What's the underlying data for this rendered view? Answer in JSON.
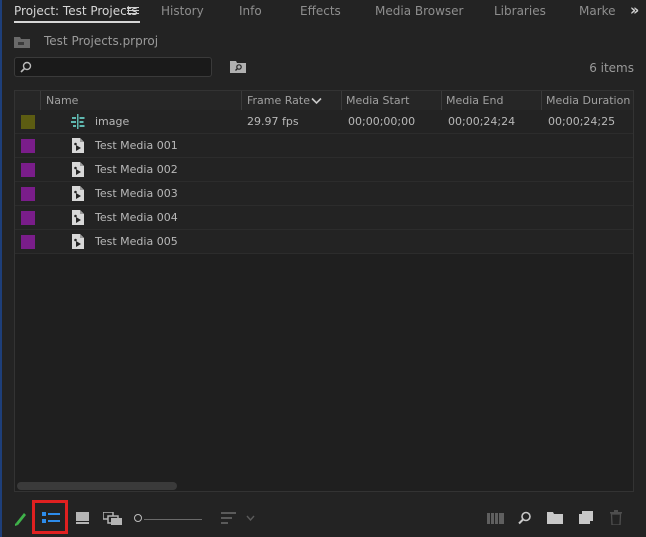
{
  "tabs": [
    {
      "label": "Project: Test Projects",
      "active": true
    },
    {
      "label": "History",
      "active": false
    },
    {
      "label": "Info",
      "active": false
    },
    {
      "label": "Effects",
      "active": false
    },
    {
      "label": "Media Browser",
      "active": false
    },
    {
      "label": "Libraries",
      "active": false
    },
    {
      "label": "Marke",
      "active": false
    }
  ],
  "project": {
    "file_name": "Test Projects.prproj"
  },
  "search": {
    "value": "",
    "placeholder": ""
  },
  "item_count": "6 items",
  "columns": [
    "Name",
    "Frame Rate",
    "Media Start",
    "Media End",
    "Media Duration"
  ],
  "rows": [
    {
      "name": "image",
      "frame_rate": "29.97 fps",
      "media_start": "00;00;00;00",
      "media_end": "00;00;24;24",
      "media_duration": "00;00;24;25",
      "swatch_color": "#5c5c12",
      "icon": "sequence-icon"
    },
    {
      "name": "Test Media 001",
      "frame_rate": "",
      "media_start": "",
      "media_end": "",
      "media_duration": "",
      "swatch_color": "#7a1d8a",
      "icon": "media-file-icon"
    },
    {
      "name": "Test Media 002",
      "frame_rate": "",
      "media_start": "",
      "media_end": "",
      "media_duration": "",
      "swatch_color": "#7a1d8a",
      "icon": "media-file-icon"
    },
    {
      "name": "Test Media 003",
      "frame_rate": "",
      "media_start": "",
      "media_end": "",
      "media_duration": "",
      "swatch_color": "#7a1d8a",
      "icon": "media-file-icon"
    },
    {
      "name": "Test Media 004",
      "frame_rate": "",
      "media_start": "",
      "media_end": "",
      "media_duration": "",
      "swatch_color": "#7a1d8a",
      "icon": "media-file-icon"
    },
    {
      "name": "Test Media 005",
      "frame_rate": "",
      "media_start": "",
      "media_end": "",
      "media_duration": "",
      "swatch_color": "#7a1d8a",
      "icon": "media-file-icon"
    }
  ],
  "toolbar_icons": [
    "pencil-icon",
    "list-view-icon",
    "icon-view-icon",
    "freeform-view-icon",
    "zoom-slider",
    "sort-icon",
    "automate-to-sequence-icon",
    "find-icon",
    "new-bin-icon",
    "new-item-icon",
    "clear-icon"
  ],
  "colors": {
    "accent_highlight": "#e02020",
    "active_view": "#2d8ceb",
    "pencil": "#3fb24a"
  }
}
